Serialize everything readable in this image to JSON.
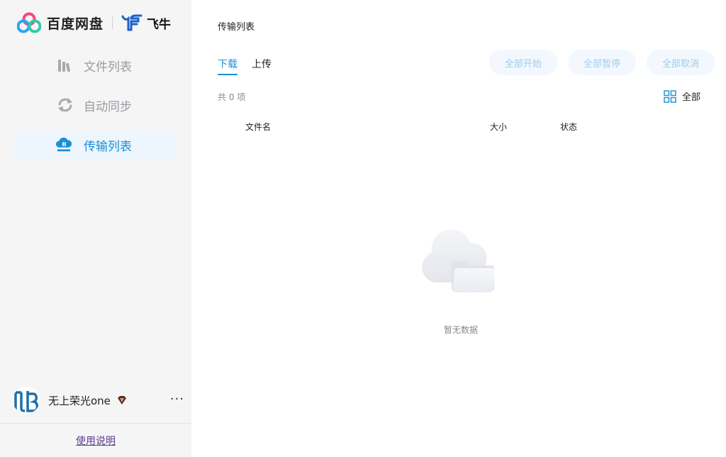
{
  "brand": {
    "name": "百度网盘",
    "partner": "飞牛"
  },
  "sidebar": {
    "items": [
      {
        "label": "文件列表",
        "icon": "books-icon",
        "active": false
      },
      {
        "label": "自动同步",
        "icon": "sync-icon",
        "active": false
      },
      {
        "label": "传输列表",
        "icon": "cloud-transfer-icon",
        "active": true
      }
    ],
    "user": {
      "name": "无上荣光one",
      "badge": "vip-diamond-icon"
    },
    "more_label": "···",
    "help_label": "使用说明"
  },
  "main": {
    "title": "传输列表",
    "tabs": [
      {
        "label": "下载",
        "active": true
      },
      {
        "label": "上传",
        "active": false
      }
    ],
    "actions": {
      "start_all": "全部开始",
      "pause_all": "全部暂停",
      "cancel_all": "全部取消"
    },
    "count_text": "共 0 项",
    "filter_label": "全部",
    "columns": {
      "name": "文件名",
      "size": "大小",
      "status": "状态"
    },
    "empty_text": "暂无数据"
  },
  "colors": {
    "accent": "#1a8fd6",
    "sidebar_bg": "#f5f5f6",
    "active_bg": "#eef6fd",
    "button_bg": "#f2f8fd",
    "button_text": "#9dcdf0"
  }
}
